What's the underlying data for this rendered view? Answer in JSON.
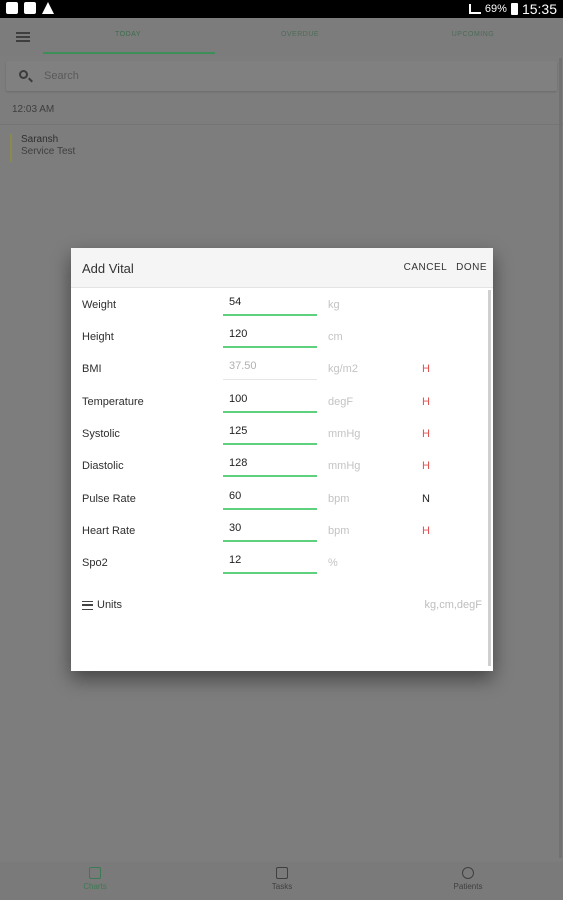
{
  "status_bar": {
    "battery": "69%",
    "time": "15:35"
  },
  "tabs": [
    "TODAY",
    "OVERDUE",
    "UPCOMING"
  ],
  "search": {
    "placeholder": "Search"
  },
  "list": {
    "time_header": "12:03 AM",
    "item": {
      "name": "Saransh",
      "subtitle": "Service Test"
    }
  },
  "bottom_nav": [
    "Charts",
    "Tasks",
    "Patients"
  ],
  "dialog": {
    "title": "Add Vital",
    "cancel_label": "CANCEL",
    "done_label": "DONE",
    "vitals": [
      {
        "label": "Weight",
        "value": "54",
        "unit": "kg",
        "flag": ""
      },
      {
        "label": "Height",
        "value": "120",
        "unit": "cm",
        "flag": ""
      },
      {
        "label": "BMI",
        "value": "37.50",
        "unit": "kg/m2",
        "flag": "H"
      },
      {
        "label": "Temperature",
        "value": "100",
        "unit": "degF",
        "flag": "H"
      },
      {
        "label": "Systolic",
        "value": "125",
        "unit": "mmHg",
        "flag": "H"
      },
      {
        "label": "Diastolic",
        "value": "128",
        "unit": "mmHg",
        "flag": "H"
      },
      {
        "label": "Pulse Rate",
        "value": "60",
        "unit": "bpm",
        "flag": "N"
      },
      {
        "label": "Heart Rate",
        "value": "30",
        "unit": "bpm",
        "flag": "H"
      },
      {
        "label": "Spo2",
        "value": "12",
        "unit": "%",
        "flag": ""
      }
    ],
    "units_label": "Units",
    "units_value": "kg,cm,degF"
  }
}
